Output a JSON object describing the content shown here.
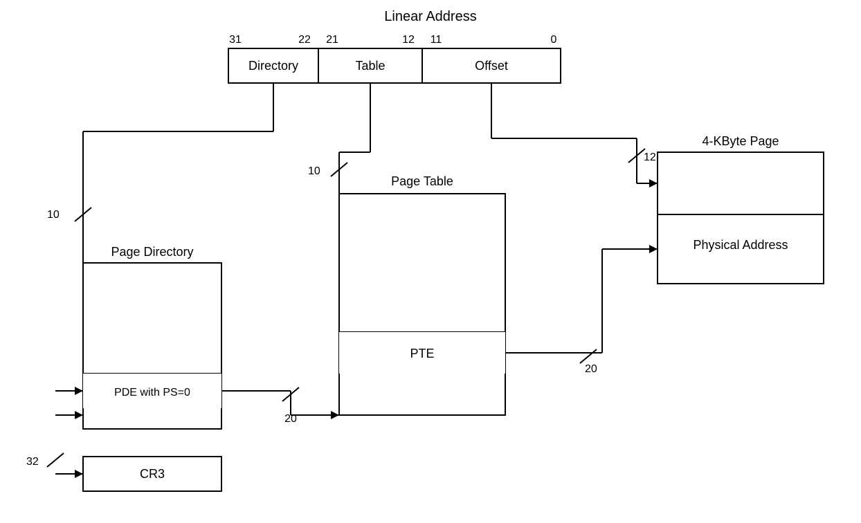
{
  "diagram": {
    "title": "Linear Address",
    "linear_address": {
      "bits": [
        "31",
        "22",
        "21",
        "12",
        "11",
        "0"
      ],
      "fields": [
        "Directory",
        "Table",
        "Offset"
      ]
    },
    "structures": {
      "page_directory": {
        "label": "Page Directory",
        "entry": "PDE with PS=0"
      },
      "page_table": {
        "label": "Page Table",
        "entry": "PTE"
      },
      "page_4k": {
        "label": "4-KByte Page",
        "entry": "Physical Address"
      },
      "cr3": {
        "label": "CR3"
      }
    },
    "annotations": {
      "dir_bits": "10",
      "table_bits": "10",
      "pte_bits": "20",
      "pde_bits": "20",
      "page_bits": "12",
      "cr3_bits": "32"
    }
  }
}
